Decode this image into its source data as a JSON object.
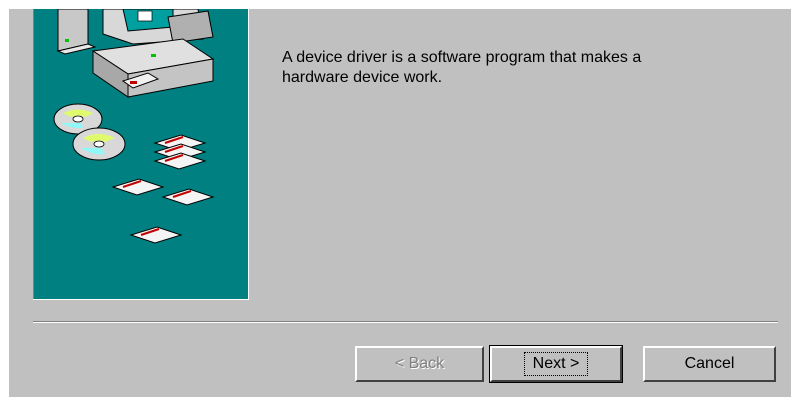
{
  "message": {
    "text": "A device driver is a software program that makes a\nhardware device work."
  },
  "buttons": {
    "back": "< Back",
    "next": "Next >",
    "cancel": "Cancel"
  },
  "colors": {
    "panel": "#c0c0c0",
    "art_background": "#008080"
  },
  "icons": {
    "art": "computer-with-disks-illustration"
  }
}
